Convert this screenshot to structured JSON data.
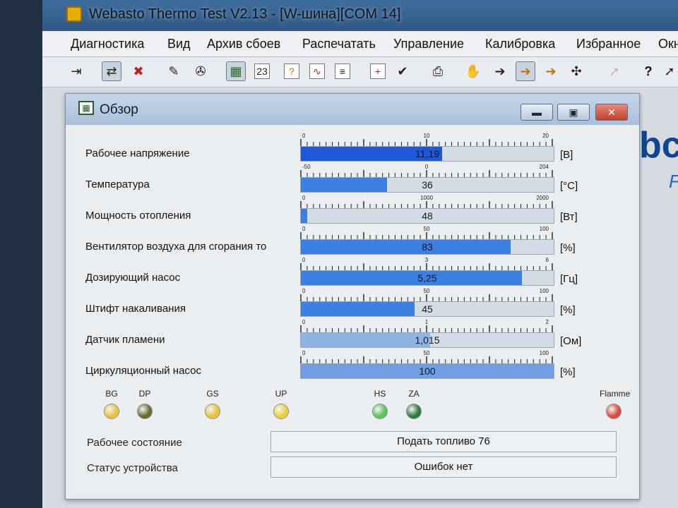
{
  "app": {
    "title": "Webasto Thermo Test V2.13 - [W-шина][COM 14]"
  },
  "menu": {
    "items": [
      "Диагностика",
      "Вид",
      "Архив сбоев",
      "Распечатать",
      "Управление",
      "Калибровка",
      "Избранное",
      "Окн"
    ]
  },
  "toolbar": {
    "icons": [
      "exit-icon",
      "refresh-icon",
      "stop-icon",
      "tool-icon",
      "paint-icon",
      "overview-icon",
      "table-icon",
      "help-box-icon",
      "chart-icon",
      "list-icon",
      "plus-icon",
      "check-icon",
      "print-icon",
      "hand-icon",
      "arrow-icon",
      "heater-on-icon",
      "heater-icon",
      "fan-icon",
      "disabled-icon",
      "question-icon",
      "pointer-icon"
    ]
  },
  "background": {
    "logo_fragment": "bc",
    "logo_fragment2": "F"
  },
  "window": {
    "title": "Обзор",
    "minimize_label": "▬",
    "maximize_label": "▣",
    "close_label": "✕"
  },
  "gauges": [
    {
      "label": "Рабочее напряжение",
      "value": "11,19",
      "unit": "[В]",
      "fraction": 0.56,
      "scale": [
        "0",
        "10",
        "20"
      ],
      "color": "#1e57d8"
    },
    {
      "label": "Температура",
      "value": "36",
      "unit": "[°C]",
      "fraction": 0.34,
      "scale": [
        "-50",
        "0",
        "204"
      ],
      "color": "#3b7fe0"
    },
    {
      "label": "Мощность отопления",
      "value": "48",
      "unit": "[Вт]",
      "fraction": 0.024,
      "scale": [
        "0",
        "1000",
        "2000"
      ],
      "color": "#3b7fe0"
    },
    {
      "label": "Вентилятор воздуха для сгорания то",
      "value": "83",
      "unit": "[%]",
      "fraction": 0.83,
      "scale": [
        "0",
        "50",
        "100"
      ],
      "color": "#3b7fe0"
    },
    {
      "label": "Дозирующий насос",
      "value": "5,25",
      "unit": "[Гц]",
      "fraction": 0.875,
      "scale": [
        "0",
        "3",
        "6"
      ],
      "color": "#3b7fe0"
    },
    {
      "label": "Штифт накаливания",
      "value": "45",
      "unit": "[%]",
      "fraction": 0.45,
      "scale": [
        "0",
        "50",
        "100"
      ],
      "color": "#3b7fe0"
    },
    {
      "label": "Датчик пламени",
      "value": "1,015",
      "unit": "[Ом]",
      "fraction": 0.51,
      "scale": [
        "0",
        "1",
        "2"
      ],
      "color": "#8fb4e4"
    },
    {
      "label": "Циркуляционный насос",
      "value": "100",
      "unit": "[%]",
      "fraction": 1.0,
      "scale": [
        "0",
        "50",
        "100"
      ],
      "color": "#6f9fe0"
    }
  ],
  "leds": [
    {
      "label": "BG",
      "color": "#e8c23a"
    },
    {
      "label": "DP",
      "color": "#6a6a2a"
    },
    {
      "label": "GS",
      "color": "#e8c23a"
    },
    {
      "label": "UP",
      "color": "#e8cf3a"
    },
    {
      "label": "HS",
      "color": "#5cc25c"
    },
    {
      "label": "ZA",
      "color": "#2a7a3a"
    },
    {
      "label": "Flamme",
      "color": "#d94a3a"
    }
  ],
  "status": {
    "operating_state_label": "Рабочее состояние",
    "operating_state_value": "Подать топливо 76",
    "device_status_label": "Статус устройства",
    "device_status_value": "Ошибок нет"
  }
}
